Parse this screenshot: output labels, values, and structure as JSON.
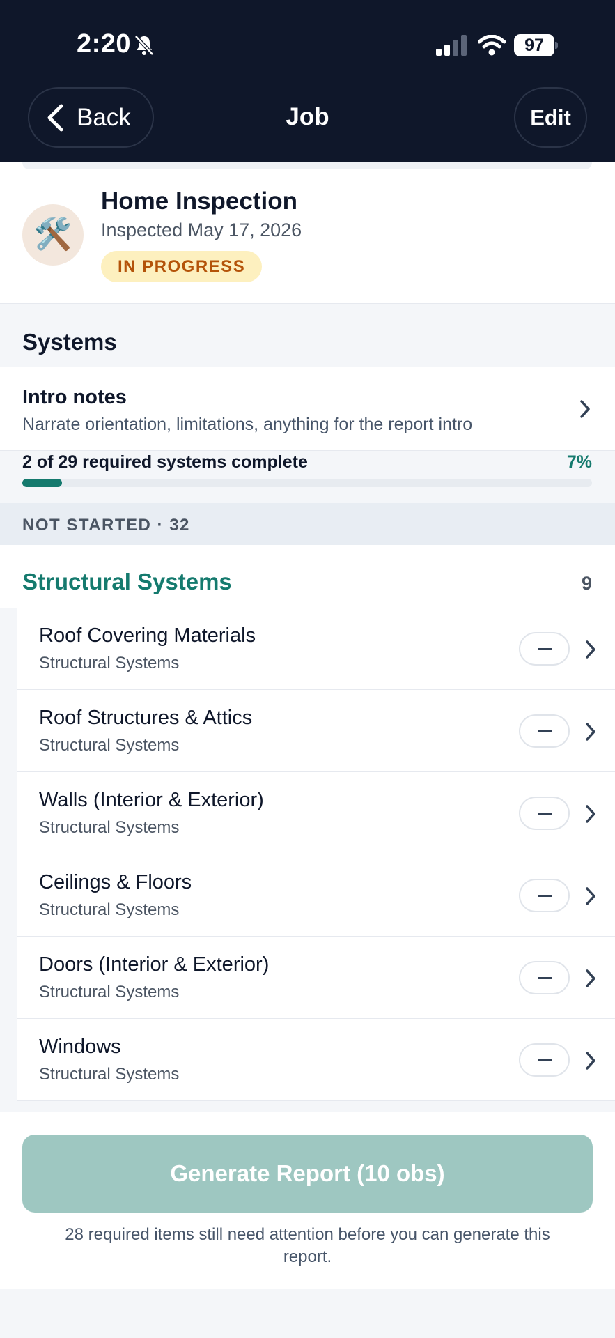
{
  "status_bar": {
    "time": "2:20",
    "battery": "97"
  },
  "nav": {
    "back_label": "Back",
    "title": "Job",
    "edit_label": "Edit"
  },
  "job": {
    "icon": "🛠️",
    "title": "Home Inspection",
    "date": "Inspected May 17, 2026",
    "status": "IN PROGRESS"
  },
  "systems": {
    "heading": "Systems"
  },
  "intro": {
    "title": "Intro notes",
    "subtitle": "Narrate orientation, limitations, anything for the report intro"
  },
  "progress": {
    "label": "2 of 29 required systems complete",
    "percent_text": "7%",
    "fraction": 0.07
  },
  "group": {
    "label": "NOT STARTED · 32"
  },
  "category": {
    "title": "Structural Systems",
    "count": "9",
    "items": [
      {
        "title": "Roof Covering Materials",
        "subtitle": "Structural Systems"
      },
      {
        "title": "Roof Structures & Attics",
        "subtitle": "Structural Systems"
      },
      {
        "title": "Walls (Interior & Exterior)",
        "subtitle": "Structural Systems"
      },
      {
        "title": "Ceilings & Floors",
        "subtitle": "Structural Systems"
      },
      {
        "title": "Doors (Interior & Exterior)",
        "subtitle": "Structural Systems"
      },
      {
        "title": "Windows",
        "subtitle": "Structural Systems"
      }
    ]
  },
  "footer": {
    "generate_label": "Generate Report (10 obs)",
    "note": "28 required items still need attention before you can generate this report."
  },
  "colors": {
    "nav_bg": "#0f172a",
    "accent": "#157a6e",
    "badge_bg": "#fdf0bf",
    "badge_text": "#b45309",
    "button_disabled": "#9ec7c1"
  },
  "icons": [
    "bell-slash-icon",
    "signal-icon",
    "wifi-icon",
    "battery-icon",
    "chevron-left-icon",
    "tools-icon",
    "chevron-right-icon",
    "minus-icon"
  ]
}
